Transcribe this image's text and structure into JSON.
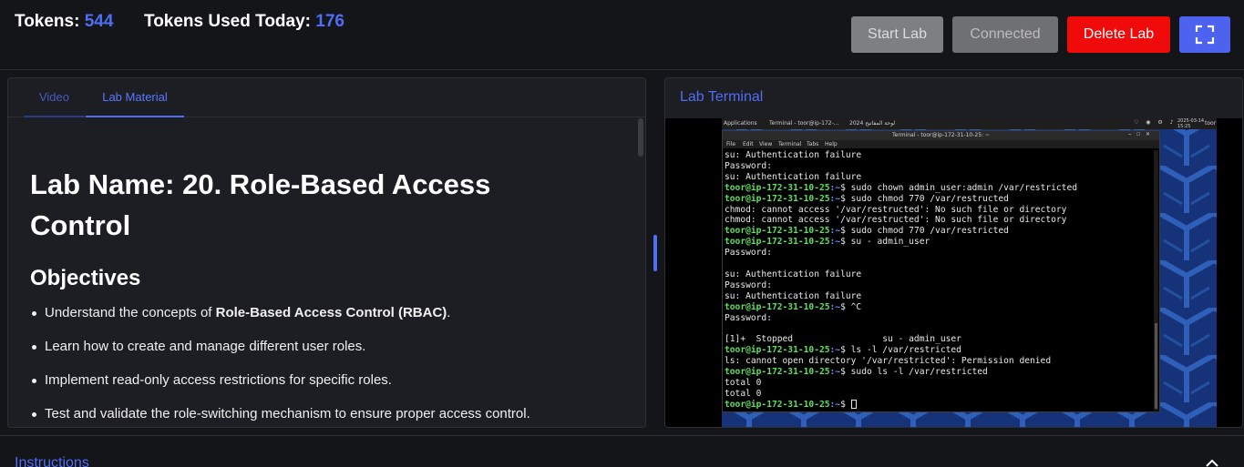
{
  "header": {
    "tokens_label": "Tokens:",
    "tokens_value": "544",
    "used_label": "Tokens Used Today:",
    "used_value": "176",
    "buttons": {
      "start": "Start Lab",
      "connected": "Connected",
      "delete": "Delete Lab",
      "fullscreen_icon": "fullscreen-icon"
    }
  },
  "left_panel": {
    "tabs": [
      "Video",
      "Lab Material"
    ],
    "active_tab": "Lab Material",
    "lab_title": "Lab Name: 20. Role-Based Access Control",
    "objectives_heading": "Objectives",
    "objectives": [
      {
        "pre": "Understand the concepts of ",
        "bold": "Role-Based Access Control (RBAC)",
        "post": "."
      },
      {
        "pre": "Learn how to create and manage different user roles.",
        "bold": "",
        "post": ""
      },
      {
        "pre": "Implement read-only access restrictions for specific roles.",
        "bold": "",
        "post": ""
      },
      {
        "pre": "Test and validate the role-switching mechanism to ensure proper access control.",
        "bold": "",
        "post": ""
      }
    ]
  },
  "right_panel": {
    "title": "Lab Terminal",
    "desktop": {
      "applications": "Applications",
      "taskbar_item": "Terminal - toor@ip-172-...",
      "arabic_text": "لوحة المفاتيح 2024",
      "clock": "2025-03-14 15:25",
      "user": "toor"
    },
    "terminal_window": {
      "title": "Terminal - toor@ip-172-31-10-25: ~",
      "menu": [
        "File",
        "Edit",
        "View",
        "Terminal",
        "Tabs",
        "Help"
      ],
      "prompt_user": "toor@ip-172-31-10-25",
      "prompt_path": ":~",
      "lines": [
        {
          "type": "out",
          "text": "su: Authentication failure"
        },
        {
          "type": "out",
          "text": "Password:"
        },
        {
          "type": "out",
          "text": "su: Authentication failure"
        },
        {
          "type": "cmd",
          "text": "sudo chown admin_user:admin /var/restricted"
        },
        {
          "type": "cmd",
          "text": "sudo chmod 770 /var/restructed"
        },
        {
          "type": "out",
          "text": "chmod: cannot access '/var/restructed': No such file or directory"
        },
        {
          "type": "out",
          "text": "chmod: cannot access '/var/restructed': No such file or directory"
        },
        {
          "type": "cmd",
          "text": "sudo chmod 770 /var/restricted"
        },
        {
          "type": "cmd",
          "text": "su - admin_user"
        },
        {
          "type": "out",
          "text": "Password:"
        },
        {
          "type": "out",
          "text": ""
        },
        {
          "type": "out",
          "text": "su: Authentication failure"
        },
        {
          "type": "out",
          "text": "Password:"
        },
        {
          "type": "out",
          "text": "su: Authentication failure"
        },
        {
          "type": "cmd",
          "text": "^C"
        },
        {
          "type": "out",
          "text": "Password:"
        },
        {
          "type": "out",
          "text": ""
        },
        {
          "type": "out",
          "text": "[1]+  Stopped                 su - admin_user"
        },
        {
          "type": "cmd",
          "text": "ls -l /var/restricted"
        },
        {
          "type": "out",
          "text": "ls: cannot open directory '/var/restricted': Permission denied"
        },
        {
          "type": "cmd",
          "text": "sudo ls -l /var/restricted"
        },
        {
          "type": "out",
          "text": "total 0"
        },
        {
          "type": "out",
          "text": "total 0"
        },
        {
          "type": "cursor",
          "text": ""
        }
      ]
    }
  },
  "bottom": {
    "instructions": "Instructions",
    "collapse_icon": "chevron-up-icon"
  },
  "colors": {
    "accent": "#4f6df5",
    "delete": "#f00a0a",
    "prompt_green": "#5fe05f"
  }
}
